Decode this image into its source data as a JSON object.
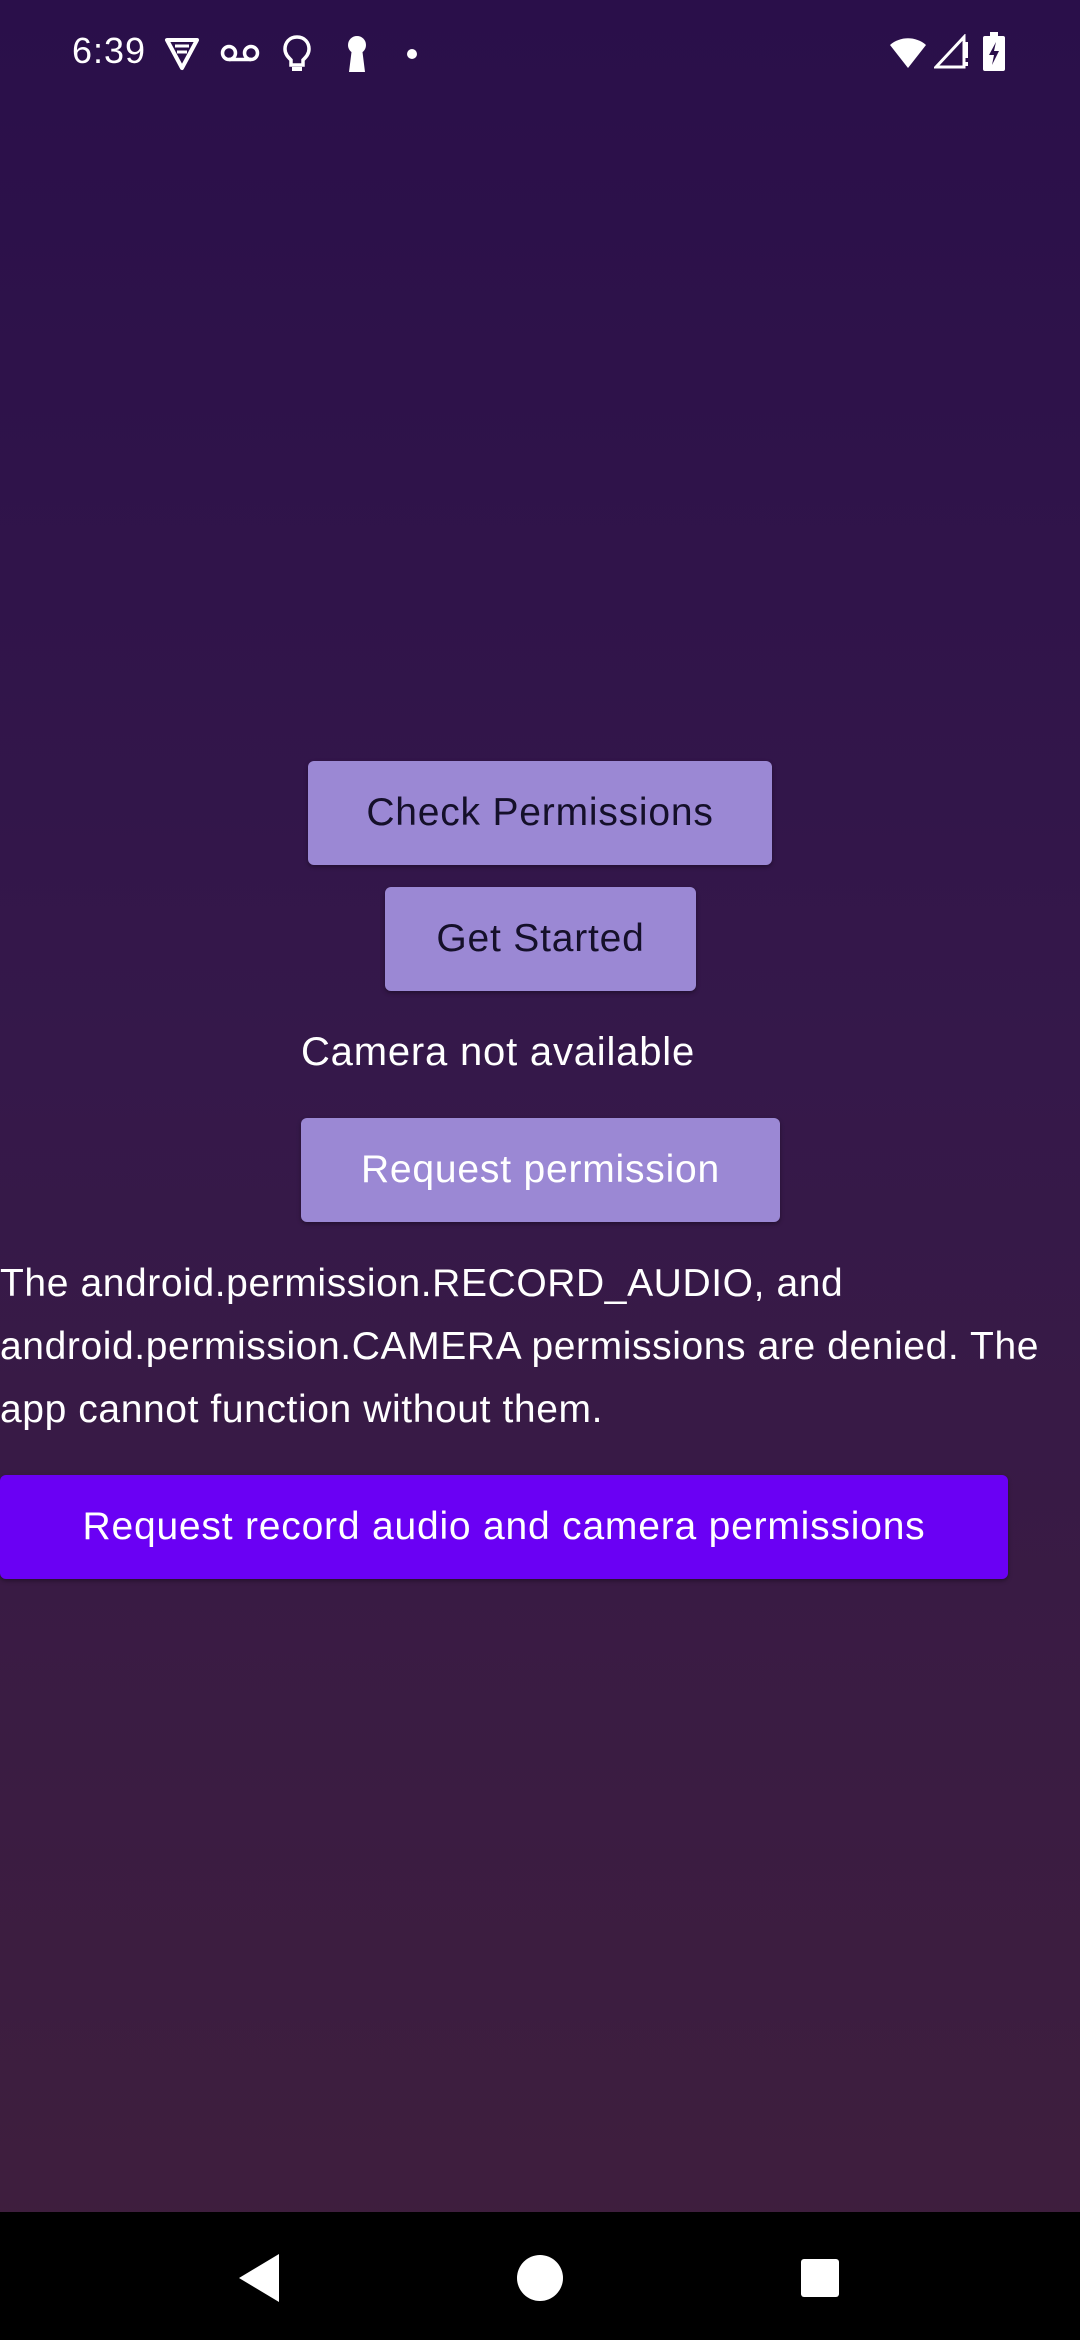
{
  "status_bar": {
    "time": "6:39",
    "left_icons": [
      "vpn-shield-icon",
      "voicemail-icon",
      "lightbulb-icon",
      "keyhole-icon",
      "dot-icon"
    ],
    "right_icons": [
      "wifi-icon",
      "cell-signal-icon",
      "battery-charging-icon"
    ]
  },
  "main": {
    "check_permissions_label": "Check Permissions",
    "get_started_label": "Get Started",
    "camera_status": "Camera not available",
    "request_permission_label": "Request permission",
    "denied_message": "The android.permission.RECORD_AUDIO, and android.permission.CAMERA permissions are denied. The app cannot function without them.",
    "request_all_label": "Request record audio and camera permissions"
  },
  "nav_bar": {
    "icons": [
      "back-icon",
      "home-icon",
      "recents-icon"
    ]
  },
  "colors": {
    "background_top": "#2a0f4a",
    "background_bottom": "#3f1f3c",
    "light_button": "#9b88d4",
    "primary_button": "#6a00f4",
    "nav_bar": "#000000"
  }
}
